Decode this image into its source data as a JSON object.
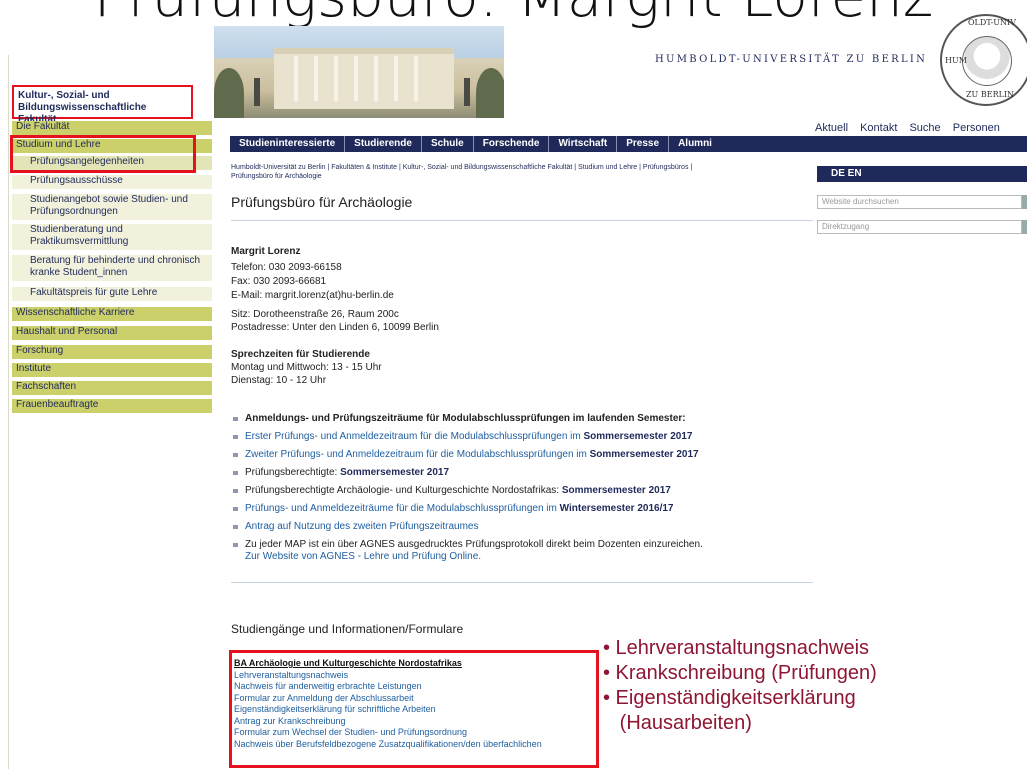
{
  "slide_title": "Prüfungsbüro: Margrit Lorenz",
  "university": {
    "name": "HUMBOLDT-UNIVERSITÄT ZU BERLIN",
    "seal_text_top": "OLDT-UNIV",
    "seal_text_bottom": "ZU BERLIN",
    "seal_text_left": "HUM"
  },
  "faculty": {
    "line1": "Kultur-, Sozial- und",
    "line2": "Bildungswissenschaftliche Fakultät"
  },
  "utility_nav": [
    "Aktuell",
    "Kontakt",
    "Suche",
    "Personen"
  ],
  "main_nav": [
    "Studieninteressierte",
    "Studierende",
    "Schule",
    "Forschende",
    "Wirtschaft",
    "Presse",
    "Alumni"
  ],
  "sidebar": {
    "items": [
      "Die Fakultät",
      "Studium und Lehre",
      "Prüfungsangelegenheiten",
      "Prüfungsausschüsse",
      "Studienangebot sowie Studien- und",
      "Prüfungsordnungen",
      "Studienberatung und",
      "Praktikumsvermittlung",
      "Beratung für behinderte und chronisch",
      "kranke Student_innen",
      "Fakultätspreis für gute Lehre",
      "Wissenschaftliche Karriere",
      "Haushalt und Personal",
      "Forschung",
      "Institute",
      "Fachschaften",
      "Frauenbeauftragte"
    ]
  },
  "breadcrumb": {
    "line1": "Humboldt-Universität zu Berlin | Fakultäten & Institute | Kultur-, Sozial- und Bildungswissenschaftliche Fakultät | Studium und Lehre | Prüfungsbüros |",
    "line2": "Prüfungsbüro für Archäologie"
  },
  "page_title": "Prüfungsbüro für Archäologie",
  "contact": {
    "name": "Margrit Lorenz",
    "phone": "Telefon: 030 2093-66158",
    "fax": "Fax: 030 2093-66681",
    "email": "E-Mail: margrit.lorenz(at)hu-berlin.de",
    "office": "Sitz: Dorotheenstraße 26, Raum 200c",
    "postal": "Postadresse: Unter den Linden 6, 10099 Berlin"
  },
  "hours": {
    "title": "Sprechzeiten für Studierende",
    "line1": "Montag und Mittwoch: 13 - 15 Uhr",
    "line2": "Dienstag: 10 - 12 Uhr"
  },
  "bullets": {
    "b1": "Anmeldungs- und Prüfungszeiträume für Modulabschlussprüfungen im laufenden Semester:",
    "b2_text": "Erster Prüfungs- und Anmeldezeitraum für die Modulabschlussprüfungen im ",
    "b2_bold": "Sommersemester 2017",
    "b3_text": "Zweiter Prüfungs- und Anmeldezeitraum für die Modulabschlussprüfungen im ",
    "b3_bold": "Sommersemester 2017",
    "b4_text": "Prüfungsberechtigte: ",
    "b4_bold": "Sommersemester 2017",
    "b5_text": "Prüfungsberechtigte Archäologie- und Kulturgeschichte Nordostafrikas: ",
    "b5_bold": "Sommersemester 2017",
    "b6_text": "Prüfungs- und Anmeldezeiträume für die Modulabschlussprüfungen im ",
    "b6_bold": "Wintersemester 2016/17",
    "b7": "Antrag auf Nutzung des zweiten Prüfungszeitraumes",
    "b8_line1": "Zu jeder MAP ist ein über AGNES ausgedrucktes Prüfungsprotokoll direkt beim Dozenten einzureichen.",
    "b8_link": "Zur Website von AGNES - Lehre und Prüfung Online."
  },
  "section_title": "Studiengänge und Informationen/Formulare",
  "ba_links": {
    "head": "BA Archäologie und Kulturgeschichte Nordostafrikas",
    "items": [
      "Lehrveranstaltungsnachweis",
      "Nachweis für anderweitig erbrachte Leistungen",
      "Formular zur Anmeldung der Abschlussarbeit",
      "Eigenständigkeitserklärung für schriftliche Arbeiten",
      "Antrag zur Krankschreibung",
      "Formular zum Wechsel der Studien- und Prüfungsordnung",
      "Nachweis über Berufsfeldbezogene Zusatzqualifikationen/den überfachlichen"
    ]
  },
  "annotations": [
    "• Lehrveranstaltungsnachweis",
    "• Krankschreibung (Prüfungen)",
    "• Eigenständigkeitserklärung",
    "   (Hausarbeiten)"
  ],
  "right_panel": {
    "lang": "DE  EN",
    "search_placeholder": "Website durchsuchen",
    "direct_placeholder": "Direktzugang"
  },
  "colors": {
    "navy": "#1f2a5a",
    "link": "#1f5fa0",
    "highlight": "#e5121d",
    "annotation": "#8e1633",
    "sidebar_active": "#ccd06a"
  }
}
